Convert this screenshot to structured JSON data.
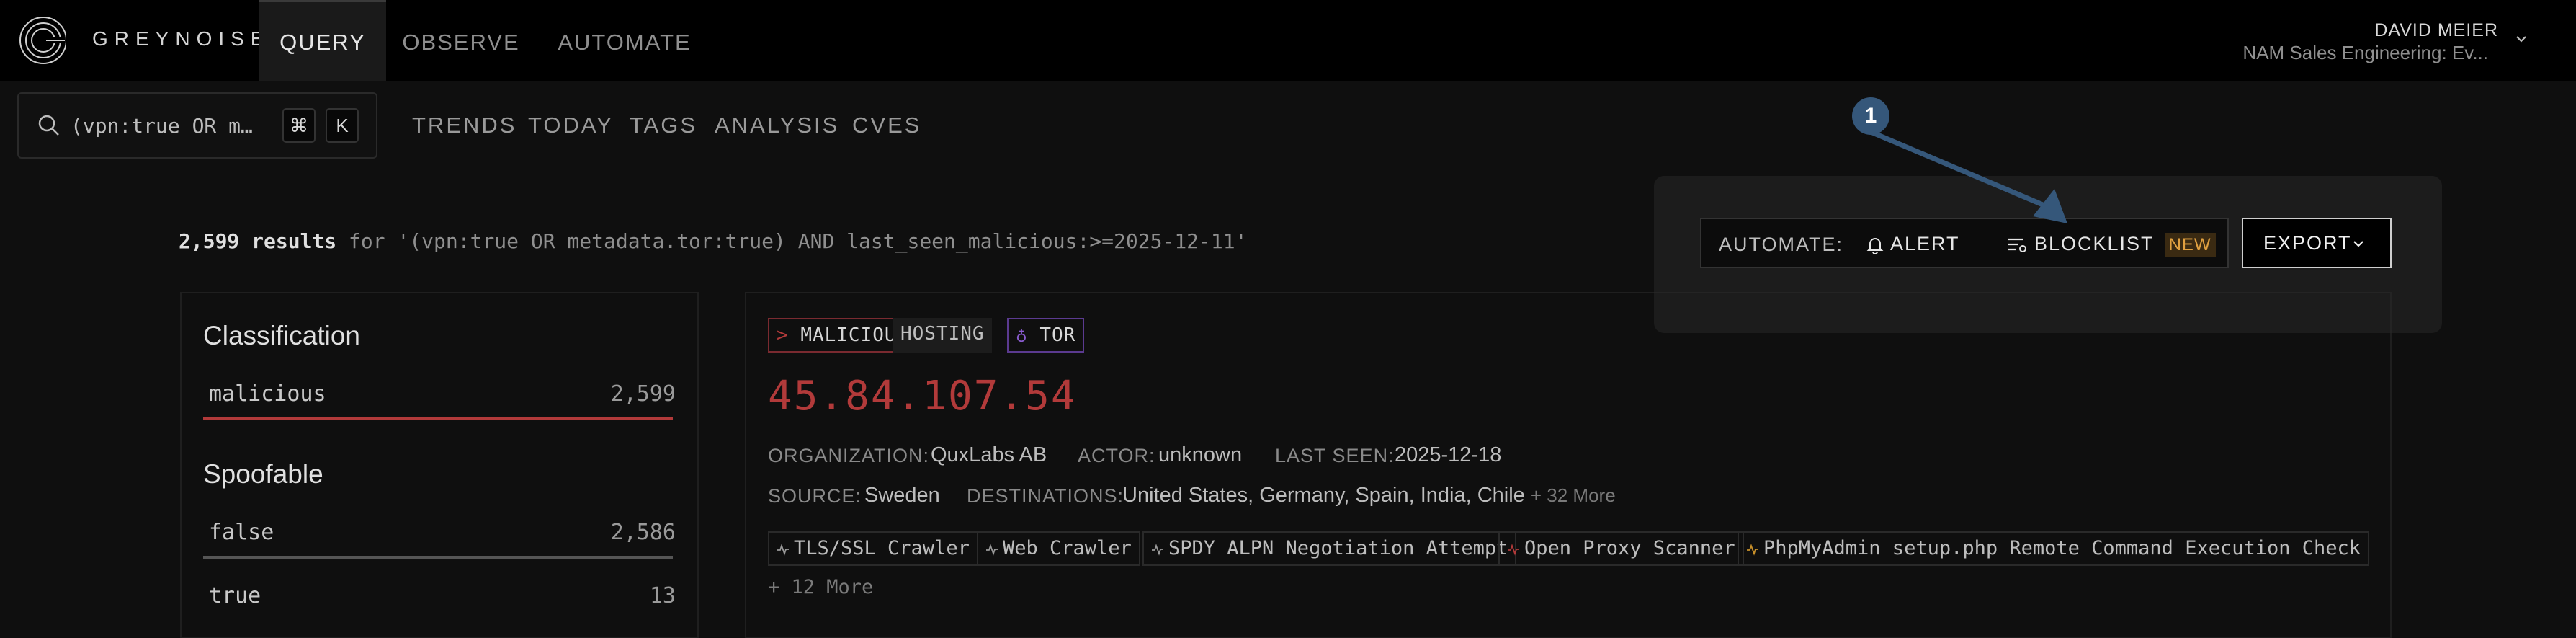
{
  "brand": {
    "name": "GREYNOISE"
  },
  "nav": {
    "tabs": [
      {
        "label": "QUERY",
        "active": true
      },
      {
        "label": "OBSERVE",
        "active": false
      },
      {
        "label": "AUTOMATE",
        "active": false
      }
    ],
    "user": {
      "name": "DAVID MEIER",
      "org": "NAM Sales Engineering: Ev..."
    }
  },
  "search": {
    "query": "(vpn:true OR m…",
    "shortcut_keys": [
      "⌘",
      "K"
    ]
  },
  "subnav": {
    "items": [
      "TRENDS",
      "TODAY",
      "TAGS",
      "ANALYSIS",
      "CVES"
    ]
  },
  "results": {
    "count": "2,599 results",
    "query_text": " for '(vpn:true OR metadata.tor:true) AND last_seen_malicious:>=2025-12-11'"
  },
  "filters": {
    "classification": {
      "heading": "Classification",
      "rows": [
        {
          "label": "malicious",
          "count": "2,599",
          "color": "#b23a3a"
        }
      ]
    },
    "spoofable": {
      "heading": "Spoofable",
      "rows": [
        {
          "label": "false",
          "count": "2,586",
          "color": "#555555"
        },
        {
          "label": "true",
          "count": "13",
          "color": "#555555"
        }
      ]
    }
  },
  "automate": {
    "label": "AUTOMATE:",
    "alert_label": "ALERT",
    "blocklist_label": "BLOCKLIST",
    "new_badge": "NEW",
    "export_label": "EXPORT",
    "step_number": "1",
    "arrow_color": "#35577a"
  },
  "card": {
    "tags": {
      "malicious": "MALICIOUS",
      "hosting": "HOSTING",
      "tor": "TOR"
    },
    "ip": "45.84.107.54",
    "ip_color": "#b23a3a",
    "organization_key": "ORGANIZATION:",
    "organization": "QuxLabs AB",
    "actor_key": "ACTOR:",
    "actor": "unknown",
    "last_seen_key": "LAST SEEN:",
    "last_seen": "2025-12-18",
    "source_key": "SOURCE:",
    "source": "Sweden",
    "destinations_key": "DESTINATIONS:",
    "destinations": "United States, Germany, Spain, India, Chile",
    "destinations_more": "+ 32 More",
    "activity_tags": [
      {
        "label": "TLS/SSL Crawler",
        "malicious": false
      },
      {
        "label": "Web Crawler",
        "malicious": false
      },
      {
        "label": "SPDY ALPN Negotiation Attempt",
        "malicious": false
      },
      {
        "label": "Open Proxy Scanner",
        "malicious": true
      },
      {
        "label": "PhpMyAdmin setup.php Remote Command Execution Check",
        "malicious": "suspicious"
      }
    ],
    "more_tags": "+ 12 More"
  }
}
